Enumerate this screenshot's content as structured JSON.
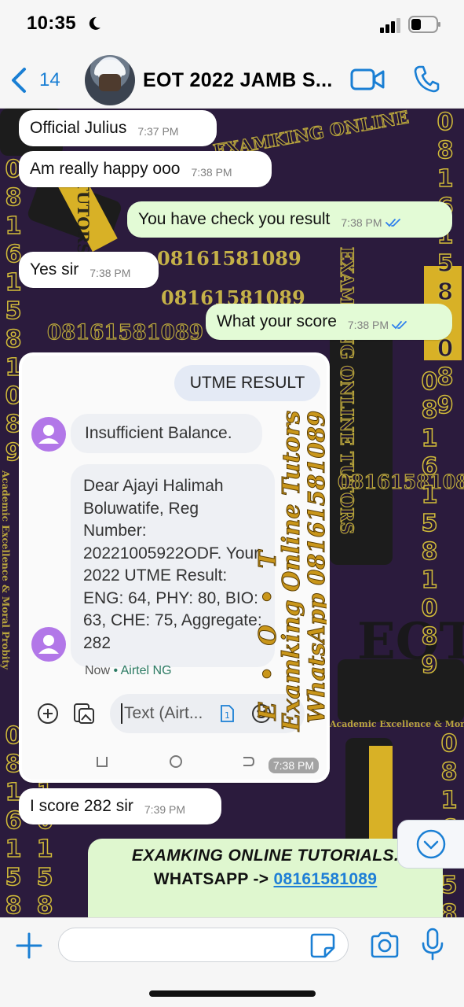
{
  "status_bar": {
    "time": "10:35"
  },
  "header": {
    "back_count": "14",
    "title": "EOT 2022 JAMB S..."
  },
  "wallpaper": {
    "phone_horizontal": "08161581089",
    "brand_arc": "EXAMKING ONLINE",
    "brand_vertical": "EXAMKING ONLINE TUTORS",
    "tutors": "TUTORS",
    "eot": "EOT",
    "academic": "Academic Excellence & Moral Probity",
    "digit_column": "08161581089"
  },
  "messages": [
    {
      "direction": "in",
      "text": "Official Julius",
      "time": "7:37 PM"
    },
    {
      "direction": "in",
      "text": "Am really happy ooo",
      "time": "7:38 PM"
    },
    {
      "direction": "out",
      "text": "You have check you result",
      "time": "7:38 PM"
    },
    {
      "direction": "in",
      "text": "Yes sir",
      "time": "7:38 PM"
    },
    {
      "direction": "out",
      "text": "What your score",
      "time": "7:38 PM"
    },
    {
      "direction": "in",
      "text": "I score 282 sir",
      "time": "7:39 PM"
    }
  ],
  "image_message": {
    "time": "7:38 PM",
    "sms_sent": "UTME RESULT",
    "sms_in1": "Insufficient Balance.",
    "sms_in2": "Dear Ajayi Halimah Boluwatife, Reg Number: 20221005922ODF. Your 2022 UTME Result: ENG: 64, PHY: 80, BIO: 63, CHE: 75, Aggregate: 282",
    "meta_time": "Now",
    "meta_sep": " • ",
    "meta_carrier": "Airtel NG",
    "compose_placeholder": "Text (Airt...",
    "sim_label": "1",
    "watermark": {
      "eot": "E • O • T",
      "line1": "Examking Online Tutors",
      "line2": "WhatsApp 08161581089"
    }
  },
  "promo": {
    "line1": "EXAMKING ONLINE TUTORIALS.",
    "line2_prefix": "WHATSAPP -> ",
    "line2_link": "08161581089"
  },
  "icons": {
    "back": "chevron-left-icon",
    "video": "video-call-icon",
    "phone": "phone-call-icon",
    "plus": "plus-icon",
    "sticker": "sticker-icon",
    "camera": "camera-icon",
    "mic": "microphone-icon",
    "scroll_down": "chevron-down-icon"
  },
  "colors": {
    "accent": "#1a7fd4",
    "outgoing_bubble": "#e3fbd6",
    "incoming_bubble": "#ffffff",
    "wallpaper_bg": "#2b1b3d",
    "wallpaper_gold": "#d6c24a"
  }
}
